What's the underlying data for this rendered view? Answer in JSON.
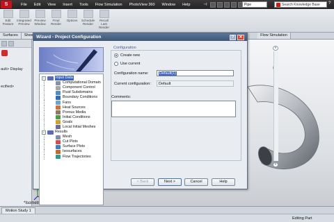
{
  "menubar": {
    "items": [
      "File",
      "Edit",
      "View",
      "Insert",
      "Tools",
      "Flow Simulation",
      "PhotoView 360",
      "Window",
      "Help"
    ],
    "document_field": "Pipe",
    "search_placeholder": "Search Knowledge Base"
  },
  "toolbar": {
    "tools": [
      {
        "line1": "Edit",
        "line2": "Feature"
      },
      {
        "line1": "Integrated",
        "line2": "Preview"
      },
      {
        "line1": "Preview",
        "line2": "Window"
      },
      {
        "line1": "Final",
        "line2": "Render"
      },
      {
        "line1": "Options",
        "line2": ""
      },
      {
        "line1": "Schedule",
        "line2": "Render"
      },
      {
        "line1": "Recall",
        "line2": "Last Render"
      }
    ]
  },
  "tabs": [
    "Surfaces",
    "Sheet",
    "Flow Simulation"
  ],
  "left_panel": {
    "lines": [
      "ault> Display",
      "ecified>"
    ]
  },
  "viewport": {
    "view_label": "*Isometric"
  },
  "bottom_tab": "Motion Study 1",
  "status": {
    "text": "Editing Part"
  },
  "dialog": {
    "title": "Wizard - Project Configuration",
    "help_glyph": "?",
    "close_glyph": "✕",
    "tree": [
      {
        "label": "Input Data",
        "level": 0,
        "expander": "−",
        "selected": true,
        "icon_color": "#5b6bbd"
      },
      {
        "label": "Computational Domain",
        "level": 1,
        "icon_color": "#8a8fa8"
      },
      {
        "label": "Component Control",
        "level": 1,
        "icon_color": "#a7a7a7"
      },
      {
        "label": "Fluid Subdomains",
        "level": 1,
        "icon_color": "#4f8ac9"
      },
      {
        "label": "Boundary Conditions",
        "level": 1,
        "icon_color": "#2f6db7"
      },
      {
        "label": "Fans",
        "level": 1,
        "icon_color": "#6aa2d6"
      },
      {
        "label": "Heat Sources",
        "level": 1,
        "icon_color": "#d0703a"
      },
      {
        "label": "Porous Media",
        "level": 1,
        "icon_color": "#8c7b5e"
      },
      {
        "label": "Initial Conditions",
        "level": 1,
        "icon_color": "#4e9a4e"
      },
      {
        "label": "Goals",
        "level": 1,
        "icon_color": "#c9a227"
      },
      {
        "label": "Local Initial Meshes",
        "level": 1,
        "icon_color": "#6b6b9a"
      },
      {
        "label": "Results",
        "level": 0,
        "expander": "−",
        "selected": false,
        "icon_color": "#5b6bbd"
      },
      {
        "label": "Mesh",
        "level": 1,
        "icon_color": "#7f8fa6"
      },
      {
        "label": "Cut Plots",
        "level": 1,
        "icon_color": "#d14f4f"
      },
      {
        "label": "Surface Plots",
        "level": 1,
        "icon_color": "#3f7fbf"
      },
      {
        "label": "Isosurfaces",
        "level": 1,
        "icon_color": "#c46a2d"
      },
      {
        "label": "Flow Trajectories",
        "level": 1,
        "icon_color": "#2e9b8f"
      }
    ],
    "section_label": "Configuration",
    "create_new_label": "Create new",
    "use_current_label": "Use current",
    "selected_option": "create_new",
    "name_label": "Configuration name:",
    "name_value": "Default(1)",
    "current_label": "Current configuration:",
    "current_value": "Default",
    "comments_label": "Comments:",
    "comments_value": "",
    "buttons": {
      "back": "< Back",
      "next": "Next >",
      "cancel": "Cancel",
      "help": "Help"
    }
  }
}
